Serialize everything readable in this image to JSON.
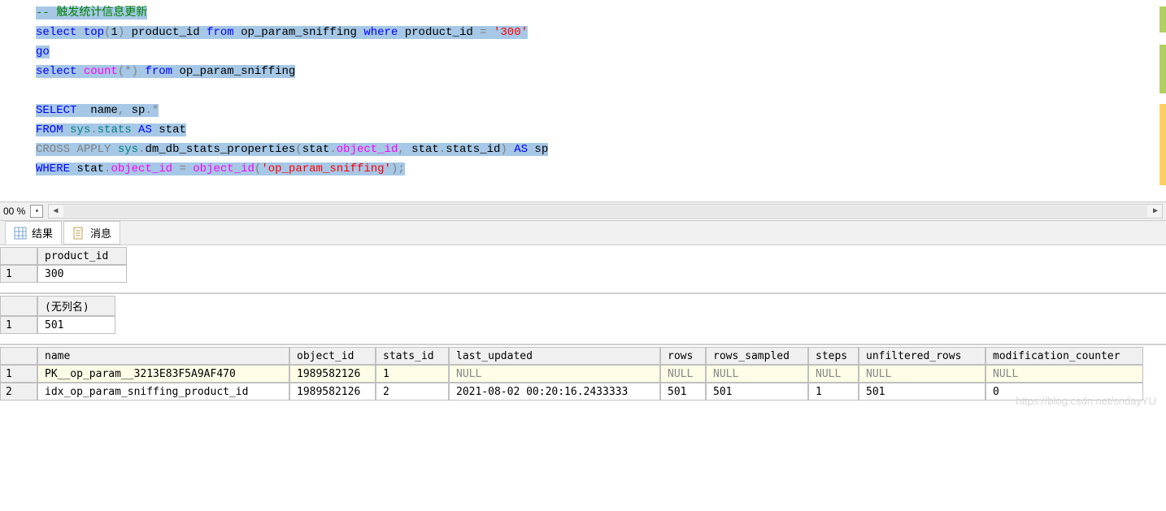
{
  "editor": {
    "lines": {
      "l1_comment": "-- 触发统计信息更新",
      "l2_select": "select",
      "l2_top": " top",
      "l2_paren_o": "(",
      "l2_one": "1",
      "l2_paren_c": ")",
      "l2_mid": " product_id ",
      "l2_from": "from",
      "l2_tbl": " op_param_sniffing ",
      "l2_where": "where",
      "l2_cond": " product_id ",
      "l2_eq": "=",
      "l2_sp": " ",
      "l2_str": "'300'",
      "l3_go": "go",
      "l4_select": "select",
      "l4_sp1": " ",
      "l4_count": "count",
      "l4_paren_o": "(",
      "l4_star": "*",
      "l4_paren_c": ")",
      "l4_sp2": " ",
      "l4_from": "from",
      "l4_tbl": " op_param_sniffing",
      "l6_select": "SELECT",
      "l6_cols": "  name",
      "l6_comma": ",",
      "l6_rest": " sp",
      "l6_dot": ".",
      "l6_star": "*",
      "l7_from": "FROM",
      "l7_sp": " ",
      "l7_sys": "sys",
      "l7_dot1": ".",
      "l7_stats": "stats",
      "l7_as": " AS",
      "l7_alias": " stat",
      "l8_cross": "CROSS",
      "l8_sp1": " ",
      "l8_apply": "APPLY",
      "l8_sp2": " ",
      "l8_sys": "sys",
      "l8_dot": ".",
      "l8_fn": "dm_db_stats_properties",
      "l8_po": "(",
      "l8_stat": "stat",
      "l8_dot2": ".",
      "l8_objid": "object_id",
      "l8_comma": ",",
      "l8_sp3": " stat",
      "l8_dot3": ".",
      "l8_sid": "stats_id",
      "l8_pc": ")",
      "l8_as": " AS",
      "l8_sp4": " sp",
      "l9_where": "WHERE",
      "l9_stat": " stat",
      "l9_dot": ".",
      "l9_objid": "object_id",
      "l9_sp": " ",
      "l9_eq": "=",
      "l9_sp2": " ",
      "l9_fn": "object_id",
      "l9_po": "(",
      "l9_str": "'op_param_sniffing'",
      "l9_pc": ")",
      "l9_semi": ";"
    }
  },
  "zoom": {
    "level": "00 %"
  },
  "tabs": {
    "results": "结果",
    "messages": "消息"
  },
  "result1": {
    "header": "product_id",
    "row1": "1",
    "val1": "300"
  },
  "result2": {
    "header": "(无列名)",
    "row1": "1",
    "val1": "501"
  },
  "result3": {
    "headers": {
      "name": "name",
      "object_id": "object_id",
      "stats_id": "stats_id",
      "last_updated": "last_updated",
      "rows": "rows",
      "rows_sampled": "rows_sampled",
      "steps": "steps",
      "unfiltered_rows": "unfiltered_rows",
      "modification_counter": "modification_counter"
    },
    "rows": [
      {
        "idx": "1",
        "name": "PK__op_param__3213E83F5A9AF470",
        "object_id": "1989582126",
        "stats_id": "1",
        "last_updated": "NULL",
        "rows": "NULL",
        "rows_sampled": "NULL",
        "steps": "NULL",
        "unfiltered_rows": "NULL",
        "modification_counter": "NULL"
      },
      {
        "idx": "2",
        "name": "idx_op_param_sniffing_product_id",
        "object_id": "1989582126",
        "stats_id": "2",
        "last_updated": "2021-08-02 00:20:16.2433333",
        "rows": "501",
        "rows_sampled": "501",
        "steps": "1",
        "unfiltered_rows": "501",
        "modification_counter": "0"
      }
    ]
  },
  "watermark": "https://blog.csdn.net/sndayYU"
}
